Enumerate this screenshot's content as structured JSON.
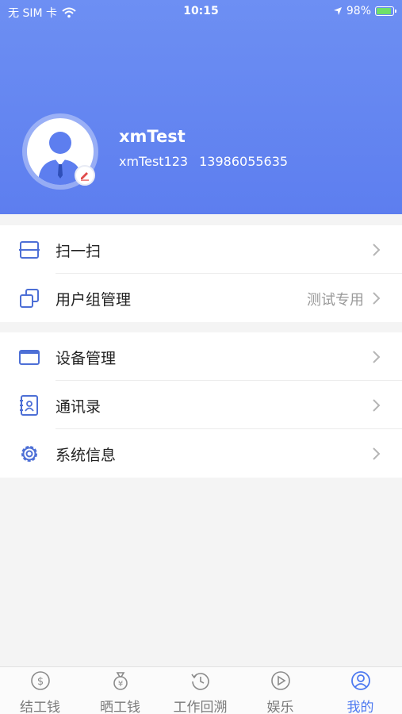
{
  "status_bar": {
    "carrier": "无 SIM 卡",
    "time": "10:15",
    "battery": "98%"
  },
  "profile": {
    "name": "xmTest",
    "username": "xmTest123",
    "phone": "13986055635"
  },
  "menu_group_1": [
    {
      "label": "扫一扫",
      "value": ""
    },
    {
      "label": "用户组管理",
      "value": "测试专用"
    }
  ],
  "menu_group_2": [
    {
      "label": "设备管理"
    },
    {
      "label": "通讯录"
    },
    {
      "label": "系统信息"
    }
  ],
  "tabbar": [
    {
      "label": "结工钱",
      "icon": "dollar-circle-icon"
    },
    {
      "label": "晒工钱",
      "icon": "money-bag-icon"
    },
    {
      "label": "工作回溯",
      "icon": "history-icon"
    },
    {
      "label": "娱乐",
      "icon": "play-circle-icon"
    },
    {
      "label": "我的",
      "icon": "user-circle-icon",
      "active": true
    }
  ],
  "colors": {
    "accent": "#4d79f0",
    "header_top": "#6d8ff3",
    "header_bottom": "#5d7eef",
    "icon": "#4d6fd6"
  }
}
